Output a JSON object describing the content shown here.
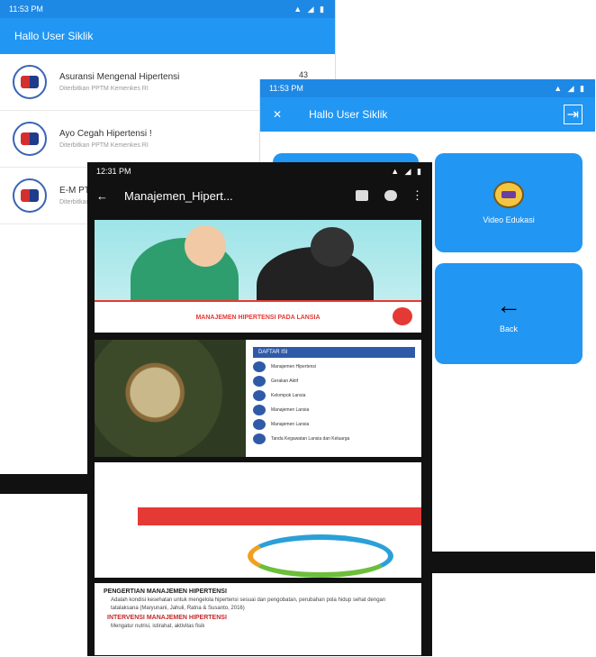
{
  "phone1": {
    "status_time": "11:53 PM",
    "status_icons": "▲ ◢ ▮",
    "appbar_title": "Hallo User Siklik",
    "items": [
      {
        "title": "Asuransi Mengenal Hipertensi",
        "subtitle": "Diterbitkan PPTM Kemenkes RI",
        "badge": "43"
      },
      {
        "title": "Ayo Cegah Hipertensi !",
        "subtitle": "Diterbitkan PPTM Kemenkes RI",
        "badge": ""
      },
      {
        "title": "E-M PTM Ayo Cegah Hipertensi",
        "subtitle": "Diterbitkan PPTM Kemenkes RI",
        "badge": ""
      }
    ]
  },
  "phone2": {
    "status_time": "11:53 PM",
    "status_icons": "▲ ◢ ▮",
    "appbar_title": "Hallo User Siklik",
    "close_glyph": "✕",
    "exit_glyph": "⇥",
    "video_label": "Video Edukasi",
    "back_label": "Back",
    "back_glyph": "←",
    "nav_glyph": "◂"
  },
  "phone3": {
    "status_time": "12:31 PM",
    "status_icons": "▲ ◢ ▮",
    "back_glyph": "←",
    "doc_title": "Manajemen_Hipert...",
    "menu_glyph": "⋮",
    "pg1_banner": "MANAJEMEN HIPERTENSI PADA LANSIA",
    "toc_title": "DAFTAR ISI",
    "toc_items": [
      "Manajemen Hipertensi",
      "Gerakan Aktif",
      "Kelompok Lansia",
      "Manajemen Lansia",
      "Manajemen Lansia",
      "Tanda Kegawatan Lansia dan Keluarga"
    ],
    "pg4_title": "PENGERTIAN MANAJEMEN HIPERTENSI",
    "pg4_body": "Adalah kondisi kesehatan untuk mengelola hipertensi sesuai dan pengobatan, perubahan pola hidup sehat dengan tatalaksana (Maryunani, Jahuli, Ratna & Susanto, 2016)",
    "pg4_sub": "INTERVENSI MANAJEMEN HIPERTENSI",
    "pg4_footer": "Mengatur nutrisi, istirahat, aktivitas fisik"
  }
}
